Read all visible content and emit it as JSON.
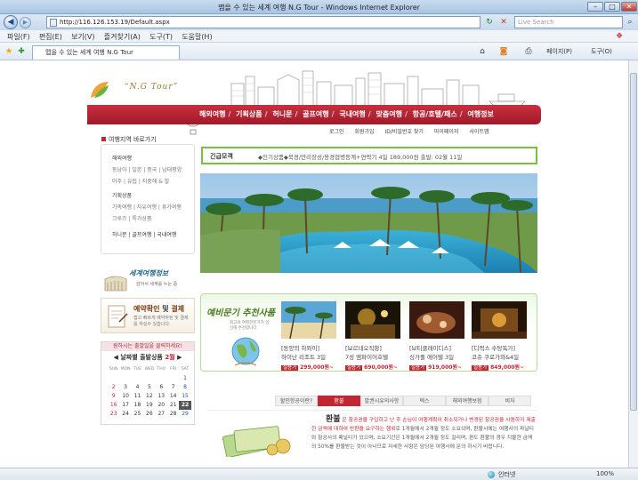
{
  "browser": {
    "window_title": "맵을 수 있는 세계 여행 N.G Tour - Windows Internet Explorer",
    "url": "http://116.126.153.19/Default.aspx",
    "search_placeholder": "Live Search",
    "menu": [
      "파일(F)",
      "편집(E)",
      "보기(V)",
      "즐겨찾기(A)",
      "도구(T)",
      "도움말(H)"
    ],
    "tab_title": "맵을 수 있는 세계 여행 N.G Tour",
    "toolbar_page": "페이지(P)",
    "toolbar_tools": "도구(O)",
    "status_zone": "인터넷",
    "zoom": "100%"
  },
  "site": {
    "brand": "“N.G Tour”",
    "main_nav": [
      "해외여행",
      "기획상품",
      "허니문",
      "골프여행",
      "국내여행",
      "맞춤여행",
      "항공/호텔/패스",
      "여행정보"
    ],
    "sub_nav": [
      "로그인",
      "회원가입",
      "ID/비밀번호 찾기",
      "마이페이지",
      "사이트맵"
    ]
  },
  "sidebar": {
    "heading": "여행지역 바로가기",
    "groups": [
      {
        "title": "해외여행",
        "items": [
          "동남아 | 일본 | 중국 | 남태평양",
          "미주 | 유럽 | 지중해 & 발"
        ]
      },
      {
        "title": "기획상품",
        "items": [
          "가족여행 | 자유여행 | 휴가여행",
          "크루즈 | 특가상품"
        ]
      },
      {
        "title": "허니문 | 골프여행 | 국내여행",
        "items": []
      }
    ],
    "promo1_line1": "세계여행정보",
    "promo1_line2": "감아서 세계를 누는 중",
    "promo2_title_a": "예약확인",
    "promo2_title_b": "및",
    "promo2_title_c": "결제",
    "promo2_desc": "접고 빠르게 예약하된 및 결제를 하실수 있습니다."
  },
  "calendar": {
    "header": "원하시는 출발일을 클릭하세요!",
    "nav_label": "◀ 날짜별 출발상품",
    "month": "2월",
    "weekdays": [
      "SUN",
      "MON",
      "TUE",
      "WED",
      "THU",
      "FRI",
      "SAT"
    ],
    "weeks": [
      [
        "",
        "",
        "",
        "",
        "",
        "",
        "1"
      ],
      [
        "2",
        "3",
        "4",
        "5",
        "6",
        "7",
        "8"
      ],
      [
        "9",
        "10",
        "11",
        "12",
        "13",
        "14",
        "15"
      ],
      [
        "16",
        "17",
        "18",
        "19",
        "20",
        "21",
        "22"
      ],
      [
        "23",
        "24",
        "25",
        "26",
        "27",
        "28",
        "29"
      ]
    ],
    "selected": "22"
  },
  "ticker": {
    "label": "긴급모객",
    "text": "◆인기상품◆북경/만리장성/용경협병동계+연락기 4일   189,000원  출발: 02월 11일"
  },
  "recommend": {
    "title": "예비문기 추천사품",
    "subtitle": "최고의 여행전문가가 엄선해 추천합니다.",
    "products": [
      {
        "name": "[동양의 하와이]",
        "name2": "하이난 리조트 3일",
        "tag": "실용가",
        "price": "299,000원~"
      },
      {
        "name": "[보르네오직항]",
        "name2": "7성 엠파이어호텔",
        "tag": "실용가",
        "price": "690,000원~"
      },
      {
        "name": "[브티클래이디스]",
        "name2": "싱가폴 에어텔 3일",
        "tag": "실용가",
        "price": "919,000원~"
      },
      {
        "name": "[디럭스 수탕독가]",
        "name2": "코쥬 쿠로가와&4일",
        "tag": "실용가",
        "price": "849,000원~"
      }
    ]
  },
  "info_tabs": [
    "할인항공이란?",
    "환불",
    "발권시유의사항",
    "텍스",
    "해외여행보험",
    "비자"
  ],
  "info_active": 1,
  "refund": {
    "title": "환불",
    "text_red": "은 항공권을 구입하고 난 후 손님이 여행계획이 취소되거나 변경된 항공권을 사용하지 제출한 금액에 대하여 반환을 요구하는 행위",
    "text": "로 1개월에서 2개월 정도 소요되며, 환불시에는 여행사의 파날티와 항공사의 패널티가 있으며, 소요기간은 1개월에서 2개월 정도 걸리며, 편도 환불의 경우 지불한 금액의 50%를 환불받는 것이 아니므로 자세한 사항은 담당된 여행사에 문의 하시기 바랍니다."
  },
  "colors": {
    "brand_red": "#c32533",
    "green_border": "#7ac143",
    "ie_blue": "#a8c4e2"
  }
}
